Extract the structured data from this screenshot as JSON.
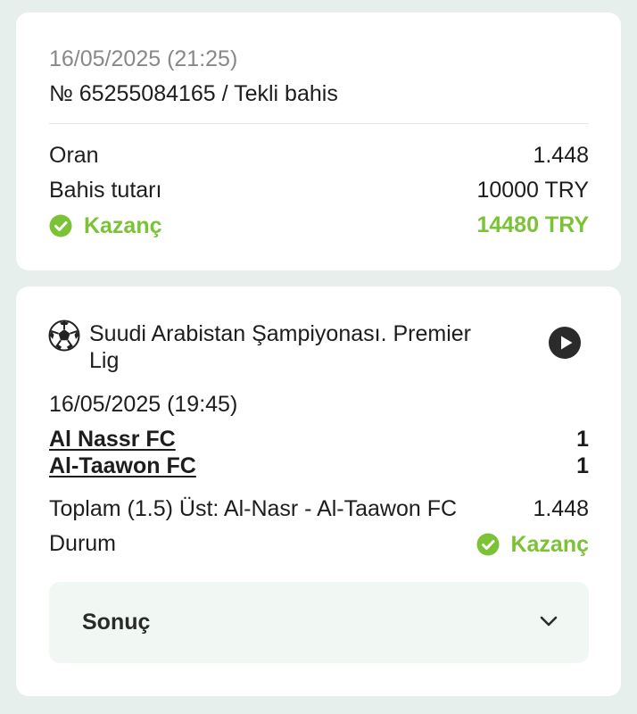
{
  "summary": {
    "datetime": "16/05/2025 (21:25)",
    "ticket": "№ 65255084165 / Tekli bahis",
    "rows": [
      {
        "label": "Oran",
        "value": "1.448"
      },
      {
        "label": "Bahis tutarı",
        "value": "10000 TRY"
      }
    ],
    "win": {
      "label": "Kazanç",
      "value": "14480 TRY"
    }
  },
  "event": {
    "league": "Suudi Arabistan Şampiyonası. Premier Lig",
    "league_line1": "Suudi Arabistan Şampiyonası. Premier",
    "league_line2": "Lig",
    "datetime": "16/05/2025 (19:45)",
    "teams": [
      {
        "name": "Al Nassr FC",
        "score": "1"
      },
      {
        "name": "Al-Taawon FC",
        "score": "1"
      }
    ],
    "market": "Toplam (1.5) Üst: Al-Nasr - Al-Taawon FC",
    "odds": "1.448",
    "status_label": "Durum",
    "status_value": "Kazanç",
    "result_label": "Sonuç"
  },
  "colors": {
    "win_green": "#7bc236",
    "background": "#e7efec",
    "result_bg": "#f1f8f4"
  },
  "icons": [
    "check-circle-icon",
    "soccer-ball-icon",
    "play-circle-icon",
    "chevron-down-icon"
  ]
}
